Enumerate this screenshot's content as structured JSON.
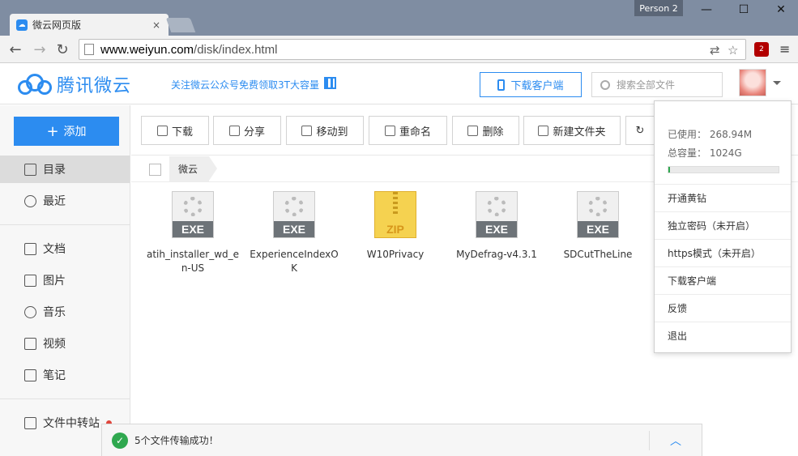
{
  "browser": {
    "tab_title": "微云网页版",
    "tab_close": "×",
    "profile_name": "Person 2",
    "url_host": "www.weiyun.com",
    "url_path": "/disk/index.html",
    "ext_badge": "2"
  },
  "header": {
    "logo_text": "腾讯微云",
    "promo": "关注微云公众号免费领取3T大容量",
    "download_client": "下载客户端",
    "search_placeholder": "搜索全部文件"
  },
  "sidebar": {
    "add_label": "添加",
    "items": [
      {
        "label": "目录",
        "icon": "list-icon"
      },
      {
        "label": "最近",
        "icon": "clock-icon"
      },
      {
        "label": "文档",
        "icon": "document-icon"
      },
      {
        "label": "图片",
        "icon": "image-icon"
      },
      {
        "label": "音乐",
        "icon": "music-icon"
      },
      {
        "label": "视频",
        "icon": "video-icon"
      },
      {
        "label": "笔记",
        "icon": "note-icon"
      },
      {
        "label": "文件中转站",
        "icon": "transfer-icon"
      }
    ]
  },
  "actions": [
    "下载",
    "分享",
    "移动到",
    "重命名",
    "删除",
    "新建文件夹"
  ],
  "breadcrumb": "微云",
  "files": [
    {
      "name": "atih_installer_wd_en-US",
      "type": "EXE"
    },
    {
      "name": "ExperienceIndexOK",
      "type": "EXE"
    },
    {
      "name": "W10Privacy",
      "type": "ZIP"
    },
    {
      "name": "MyDefrag-v4.3.1",
      "type": "EXE"
    },
    {
      "name": "SDCutTheLine",
      "type": "EXE"
    }
  ],
  "account_menu": {
    "used": "已使用： 268.94M",
    "total": "总容量： 1024G",
    "used_fraction": 0.0003,
    "items": [
      "开通黄钻",
      "独立密码（未开启）",
      "https模式（未开启）",
      "下载客户端",
      "反馈",
      "退出"
    ]
  },
  "toast": {
    "message": "5个文件传输成功！"
  },
  "colors": {
    "accent": "#2c8cf0",
    "success": "#2fa84f"
  }
}
